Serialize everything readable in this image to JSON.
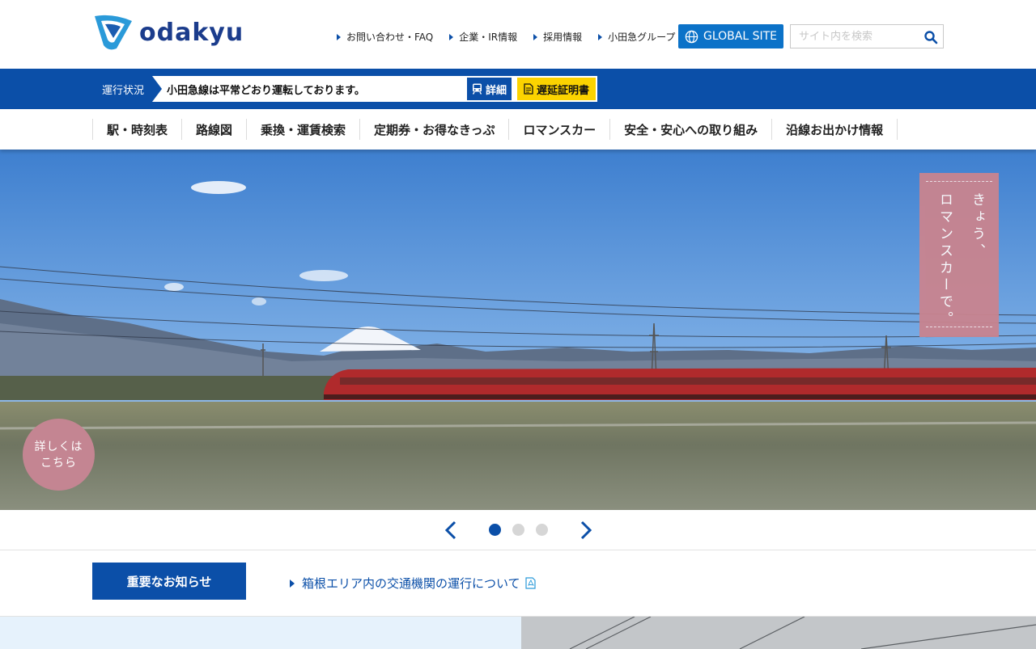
{
  "brand": {
    "logo_text": "odakyu",
    "color": "#0b4fa8"
  },
  "header": {
    "utility_links": [
      "お問い合わせ・FAQ",
      "企業・IR情報",
      "採用情報",
      "小田急グループ"
    ],
    "global_button": "GLOBAL SITE",
    "search": {
      "placeholder": "サイト内を検索",
      "icon": "search-icon"
    }
  },
  "status": {
    "label": "運行状況",
    "message": "小田急線は平常どおり運転しております。",
    "detail_button": "詳細",
    "delay_cert_button": "遅延証明書"
  },
  "nav": {
    "items": [
      "駅・時刻表",
      "路線図",
      "乗換・運賃検索",
      "定期券・お得なきっぷ",
      "ロマンスカー",
      "安全・安心への取り組み",
      "沿線お出かけ情報"
    ]
  },
  "hero": {
    "vertical_text": [
      "きょう、",
      "ロマンスカーで。"
    ],
    "badge_lines": [
      "詳しくは",
      "こちら"
    ],
    "slide_count": 3,
    "active_slide": 1
  },
  "notice": {
    "label": "重要なお知らせ",
    "link": "箱根エリア内の交通機関の運行について"
  }
}
